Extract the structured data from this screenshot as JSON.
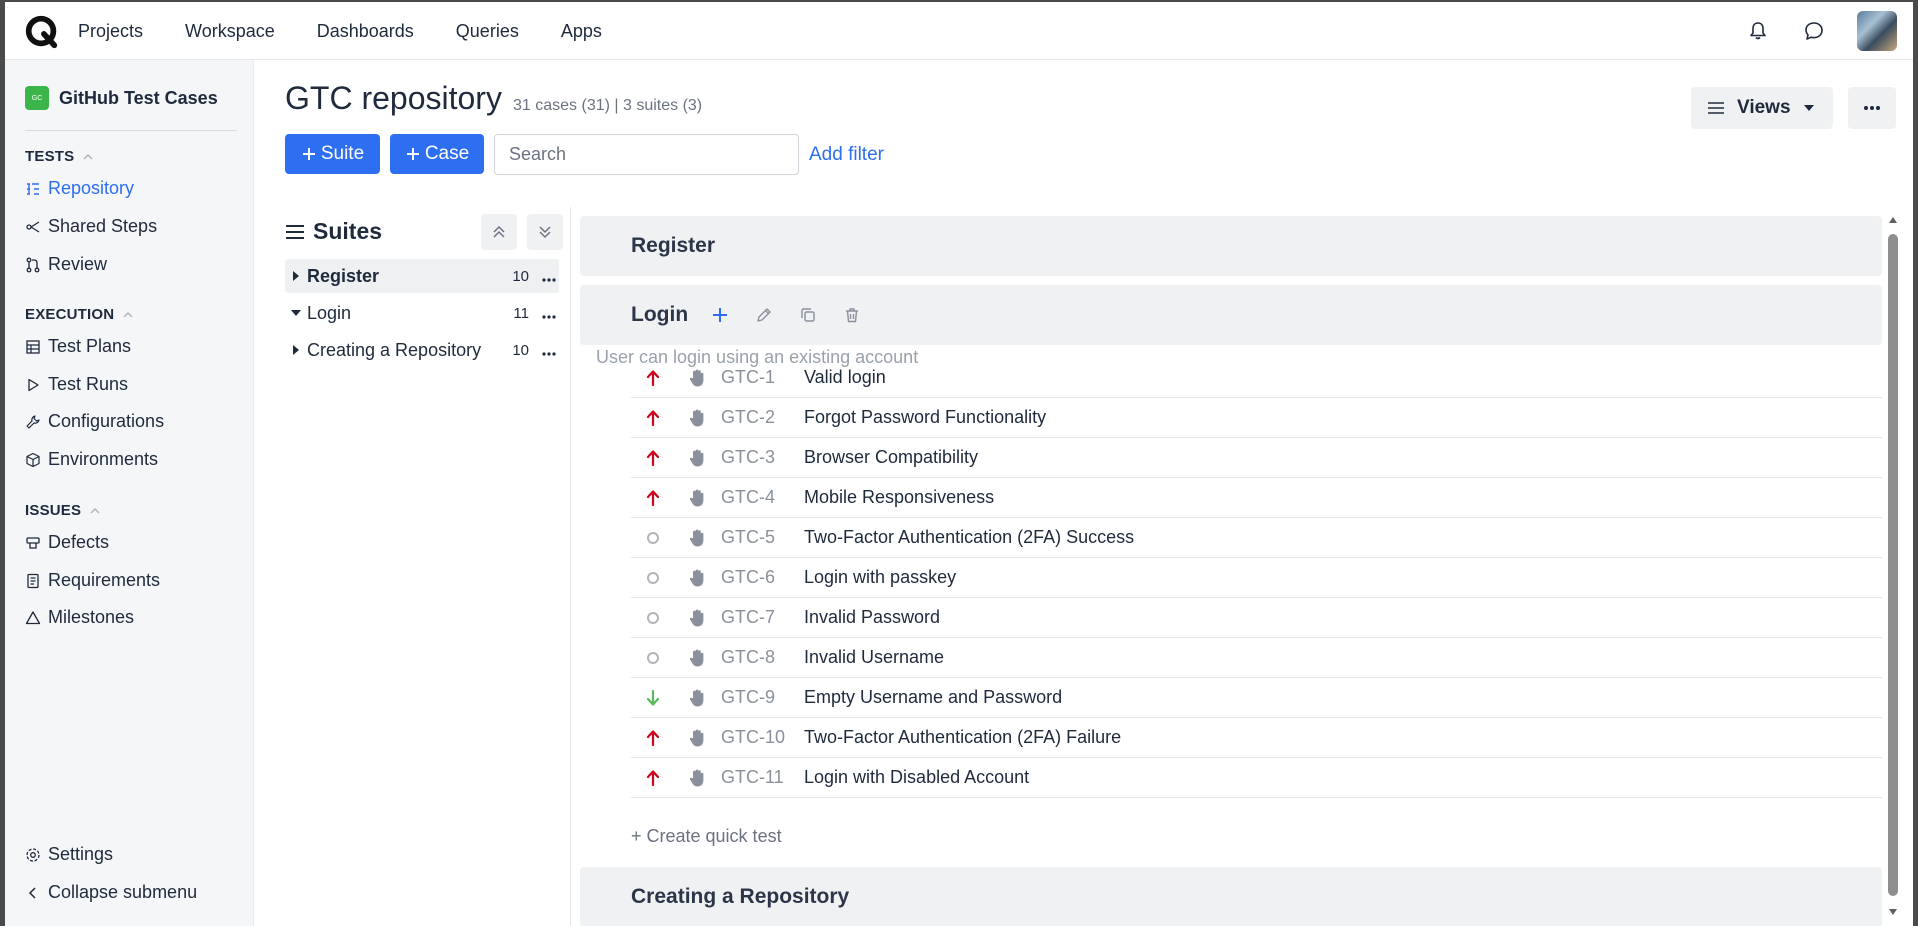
{
  "topnav": {
    "items": [
      "Projects",
      "Workspace",
      "Dashboards",
      "Queries",
      "Apps"
    ]
  },
  "sidebar": {
    "project_badge": "GC",
    "project_name": "GitHub Test Cases",
    "sections": {
      "tests": "TESTS",
      "execution": "EXECUTION",
      "issues": "ISSUES"
    },
    "items": {
      "repository": "Repository",
      "shared_steps": "Shared Steps",
      "review": "Review",
      "test_plans": "Test Plans",
      "test_runs": "Test Runs",
      "configurations": "Configurations",
      "environments": "Environments",
      "defects": "Defects",
      "requirements": "Requirements",
      "milestones": "Milestones",
      "settings": "Settings",
      "collapse": "Collapse submenu"
    }
  },
  "header": {
    "title": "GTC repository",
    "meta": "31 cases (31) | 3 suites (3)",
    "views_label": "Views",
    "suite_button": "Suite",
    "case_button": "Case",
    "search_placeholder": "Search",
    "add_filter": "Add filter"
  },
  "suites_panel": {
    "title": "Suites",
    "suites": [
      {
        "name": "Register",
        "count": "10",
        "expanded": false
      },
      {
        "name": "Login",
        "count": "11",
        "expanded": true
      },
      {
        "name": "Creating a Repository",
        "count": "10",
        "expanded": false
      }
    ]
  },
  "content": {
    "groups": {
      "register": "Register",
      "login": "Login",
      "creating": "Creating a Repository"
    },
    "login_description": "User can login using an existing account",
    "cases": [
      {
        "priority": "high",
        "id": "GTC-1",
        "title": "Valid login"
      },
      {
        "priority": "high",
        "id": "GTC-2",
        "title": "Forgot Password Functionality"
      },
      {
        "priority": "high",
        "id": "GTC-3",
        "title": "Browser Compatibility"
      },
      {
        "priority": "high",
        "id": "GTC-4",
        "title": "Mobile Responsiveness"
      },
      {
        "priority": "none",
        "id": "GTC-5",
        "title": "Two-Factor Authentication (2FA) Success"
      },
      {
        "priority": "none",
        "id": "GTC-6",
        "title": "Login with passkey"
      },
      {
        "priority": "none",
        "id": "GTC-7",
        "title": "Invalid Password"
      },
      {
        "priority": "none",
        "id": "GTC-8",
        "title": "Invalid Username"
      },
      {
        "priority": "low",
        "id": "GTC-9",
        "title": "Empty Username and Password"
      },
      {
        "priority": "high",
        "id": "GTC-10",
        "title": "Two-Factor Authentication (2FA) Failure"
      },
      {
        "priority": "high",
        "id": "GTC-11",
        "title": "Login with Disabled Account"
      }
    ],
    "quick_test": "+ Create quick test"
  },
  "colors": {
    "accent": "#2e6ef0",
    "priority_high": "#d0021b",
    "priority_low": "#5cb85c",
    "priority_none": "#b0b5bc",
    "project_badge": "#3bb54a"
  }
}
